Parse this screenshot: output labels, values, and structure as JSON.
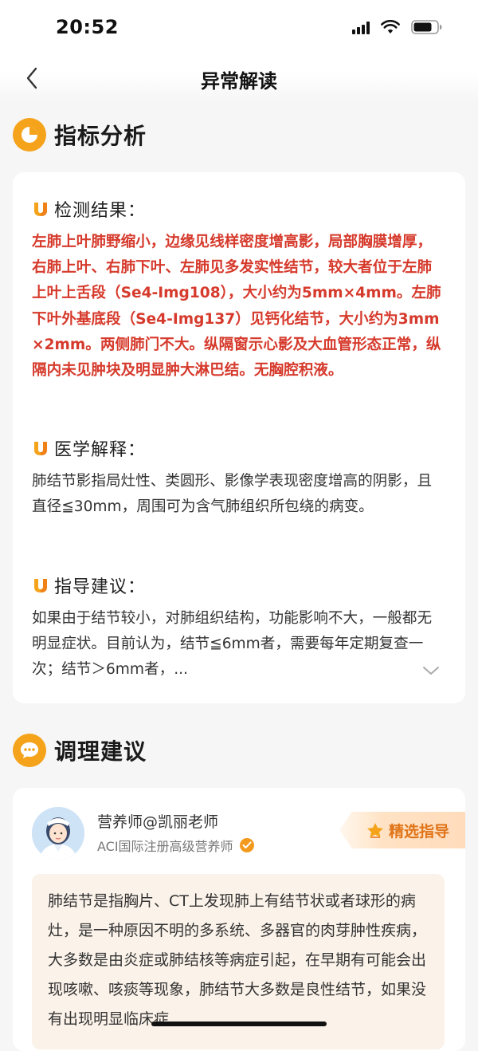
{
  "status_bar": {
    "time": "20:52"
  },
  "nav": {
    "title": "异常解读"
  },
  "analysis": {
    "section_title": "指标分析",
    "result": {
      "title": "检测结果：",
      "text": "左肺上叶肺野缩小，边缘见线样密度增高影，局部胸膜增厚，右肺上叶、右肺下叶、左肺见多发实性结节，较大者位于左肺上叶上舌段（Se4-Img108），大小约为5mm×4mm。左肺下叶外基底段（Se4-Img137）见钙化结节，大小约为3mm×2mm。两侧肺门不大。纵隔窗示心影及大血管形态正常，纵隔内未见肿块及明显肿大淋巴结。无胸腔积液。"
    },
    "explanation": {
      "title": "医学解释：",
      "text": "肺结节影指局灶性、类圆形、影像学表现密度增高的阴影，且直径≦30mm，周围可为含气肺组织所包绕的病变。"
    },
    "guidance": {
      "title": "指导建议：",
      "text": "如果由于结节较小，对肺组织结构，功能影响不大，一般都无明显症状。目前认为，结节≦6mm者，需要每年定期复查一次；结节＞6mm者，..."
    }
  },
  "advice": {
    "section_title": "调理建议",
    "expert_name": "营养师@凯丽老师",
    "expert_title": "ACI国际注册高级营养师",
    "featured_label": "精选指导",
    "text": "肺结节是指胸片、CT上发现肺上有结节状或者球形的病灶，是一种原因不明的多系统、多器官的肉芽肿性疾病，大多数是由炎症或肺结核等病症引起，在早期有可能会出现咳嗽、咳痰等现象，肺结节大多数是良性结节，如果没有出现明显临床症"
  },
  "colors": {
    "accent_orange": "#f5a31a",
    "result_red": "#d63a2c",
    "featured_orange": "#e0751a"
  },
  "icons": [
    "back-arrow-icon",
    "pie-chart-icon",
    "u-icon",
    "chevron-down-icon",
    "chat-bubble-icon",
    "verified-icon",
    "crown-icon",
    "signal-icon",
    "wifi-icon",
    "battery-icon"
  ]
}
